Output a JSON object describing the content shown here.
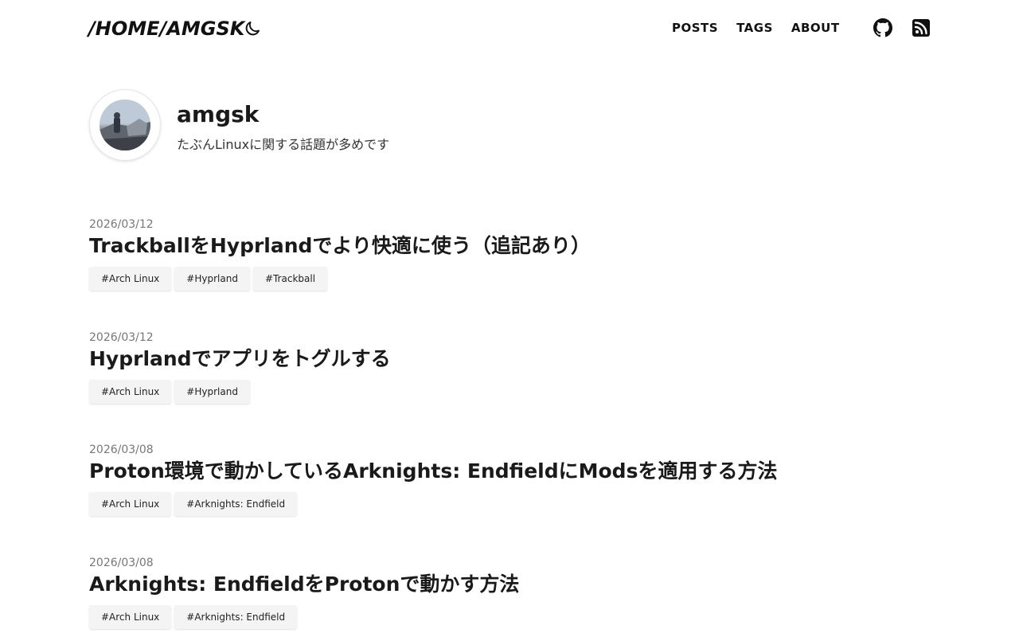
{
  "header": {
    "site_title": "/HOME/AMGSK",
    "theme_icon": "moon-icon",
    "nav": [
      "POSTS",
      "TAGS",
      "ABOUT"
    ],
    "social": [
      "github-icon",
      "rss-icon"
    ]
  },
  "profile": {
    "name": "amgsk",
    "description": "たぶんLinuxに関する話題が多めです"
  },
  "posts": [
    {
      "date": "2026/03/12",
      "title": "TrackballをHyprlandでより快適に使う（追記あり）",
      "tags": [
        "#Arch Linux",
        "#Hyprland",
        "#Trackball"
      ]
    },
    {
      "date": "2026/03/12",
      "title": "Hyprlandでアプリをトグルする",
      "tags": [
        "#Arch Linux",
        "#Hyprland"
      ]
    },
    {
      "date": "2026/03/08",
      "title": "Proton環境で動かしているArknights: EndfieldにModsを適用する方法",
      "tags": [
        "#Arch Linux",
        "#Arknights: Endfield"
      ]
    },
    {
      "date": "2026/03/08",
      "title": "Arknights: EndfieldをProtonで動かす方法",
      "tags": [
        "#Arch Linux",
        "#Arknights: Endfield"
      ]
    }
  ]
}
